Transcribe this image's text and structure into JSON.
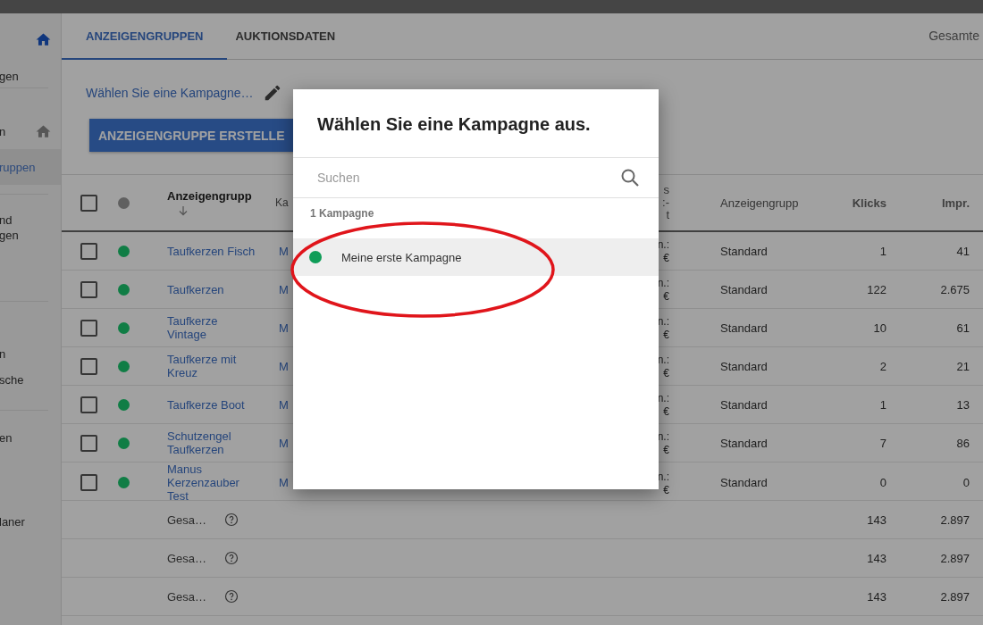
{
  "sidebar": {
    "items": [
      {
        "label": "gen",
        "selected": false,
        "kind": "home-active"
      },
      {
        "label": "n",
        "selected": false,
        "kind": "home"
      },
      {
        "label": "ruppen",
        "selected": true
      },
      {
        "label": "nd\ngen",
        "selected": false
      },
      {
        "label": "n",
        "selected": false
      },
      {
        "label": "sche",
        "selected": false
      },
      {
        "label": "en",
        "selected": false
      },
      {
        "label": "laner",
        "selected": false
      }
    ]
  },
  "tabs": [
    {
      "label": "ANZEIGENGRUPPEN",
      "selected": true
    },
    {
      "label": "AUKTIONSDATEN",
      "selected": false
    }
  ],
  "totals_header": "Gesamte",
  "campaign_picker": {
    "label": "Wählen Sie eine Kampagne…"
  },
  "create_button": "ANZEIGENGRUPPE ERSTELLE",
  "table": {
    "select_all_checked": false,
    "columns": [
      {
        "label": "Anzeigengrupp",
        "sorted": true
      },
      {
        "label": "Ka"
      },
      {
        "label": "s\n:-\nt"
      },
      {
        "label": "Anzeigengrupp"
      },
      {
        "label": "Klicks"
      },
      {
        "label": "Impr."
      }
    ],
    "rows": [
      {
        "checked": false,
        "color": "#107d45",
        "name": "Taufkerzen Fisch",
        "campaign": "M",
        "bid": "n.:\n€",
        "type": "Standard",
        "clicks": "1",
        "impressions": "41"
      },
      {
        "checked": false,
        "color": "#107d45",
        "name": "Taufkerzen",
        "campaign": "M",
        "bid": "n.:\n€",
        "type": "Standard",
        "clicks": "122",
        "impressions": "2.675"
      },
      {
        "checked": false,
        "color": "#107d45",
        "name": "Taufkerze Vintage",
        "campaign": "M",
        "bid": "n.:\n€",
        "type": "Standard",
        "clicks": "10",
        "impressions": "61"
      },
      {
        "checked": false,
        "color": "#107d45",
        "name": "Taufkerze mit Kreuz",
        "campaign": "M",
        "bid": "n.:\n€",
        "type": "Standard",
        "clicks": "2",
        "impressions": "21"
      },
      {
        "checked": false,
        "color": "#107d45",
        "name": "Taufkerze Boot",
        "campaign": "M",
        "bid": "n.:\n€",
        "type": "Standard",
        "clicks": "1",
        "impressions": "13"
      },
      {
        "checked": false,
        "color": "#107d45",
        "name": "Schutzengel Taufkerzen",
        "campaign": "M",
        "bid": "n.:\n€",
        "type": "Standard",
        "clicks": "7",
        "impressions": "86"
      },
      {
        "checked": false,
        "color": "#107d45",
        "name": "Manus Kerzenzauber Test",
        "campaign": "M",
        "bid": "n.:\n€",
        "type": "Standard",
        "clicks": "0",
        "impressions": "0"
      }
    ],
    "totals": [
      {
        "label": "Gesa…",
        "clicks": "143",
        "impressions": "2.897"
      },
      {
        "label": "Gesa…",
        "clicks": "143",
        "impressions": "2.897"
      },
      {
        "label": "Gesa…",
        "clicks": "143",
        "impressions": "2.897"
      }
    ]
  },
  "dialog": {
    "title": "Wählen Sie eine Kampagne aus.",
    "search": {
      "placeholder": "Suchen"
    },
    "count": "1 Kampagne",
    "items": [
      {
        "label": "Meine erste Kampagne",
        "selected": true,
        "color": "#0f9d58"
      }
    ]
  }
}
